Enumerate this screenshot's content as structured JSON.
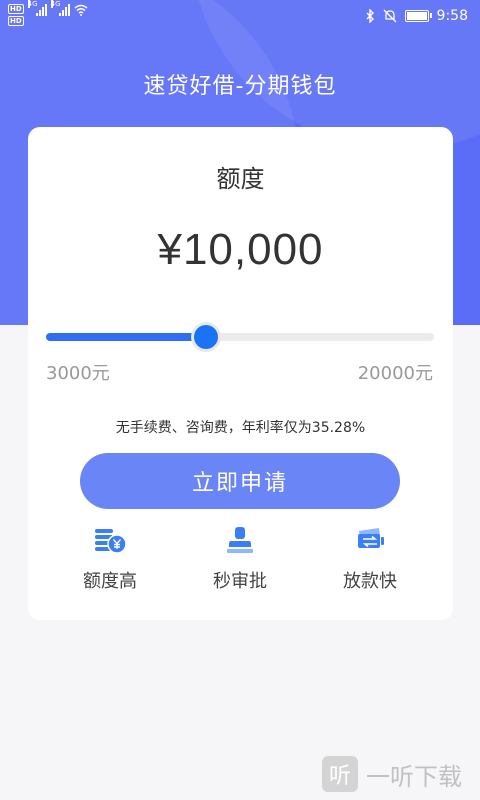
{
  "status_bar": {
    "hd1": "HD",
    "hd2": "HD",
    "net1": "4G",
    "net2": "4G",
    "time": "9:58"
  },
  "app_title": "速贷好借-分期钱包",
  "loan": {
    "label": "额度",
    "amount": "¥10,000",
    "min_label": "3000元",
    "max_label": "20000元",
    "slider_min": 3000,
    "slider_max": 20000,
    "slider_value": 10000
  },
  "fee_note": "无手续费、咨询费，年利率仅为35.28%",
  "apply_button": "立即申请",
  "features": [
    {
      "icon": "coins-yen-icon",
      "label": "额度高"
    },
    {
      "icon": "stamp-icon",
      "label": "秒审批"
    },
    {
      "icon": "cash-transfer-icon",
      "label": "放款快"
    }
  ],
  "watermark": {
    "logo": "听",
    "text": "一听下载"
  },
  "colors": {
    "primary": "#5b6df7",
    "button": "#6a86f6",
    "slider": "#1a73f5",
    "icon": "#3b7ff6"
  }
}
